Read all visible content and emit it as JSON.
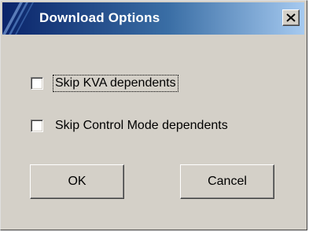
{
  "window": {
    "title": "Download Options",
    "close_icon": "close-icon"
  },
  "options": [
    {
      "label": "Skip KVA dependents",
      "checked": false,
      "focused": true
    },
    {
      "label": "Skip Control Mode dependents",
      "checked": false,
      "focused": false
    }
  ],
  "buttons": {
    "ok_label": "OK",
    "cancel_label": "Cancel"
  },
  "colors": {
    "title_gradient_start": "#0a246a",
    "title_gradient_end": "#a6caf0",
    "face": "#d4d0c8"
  }
}
